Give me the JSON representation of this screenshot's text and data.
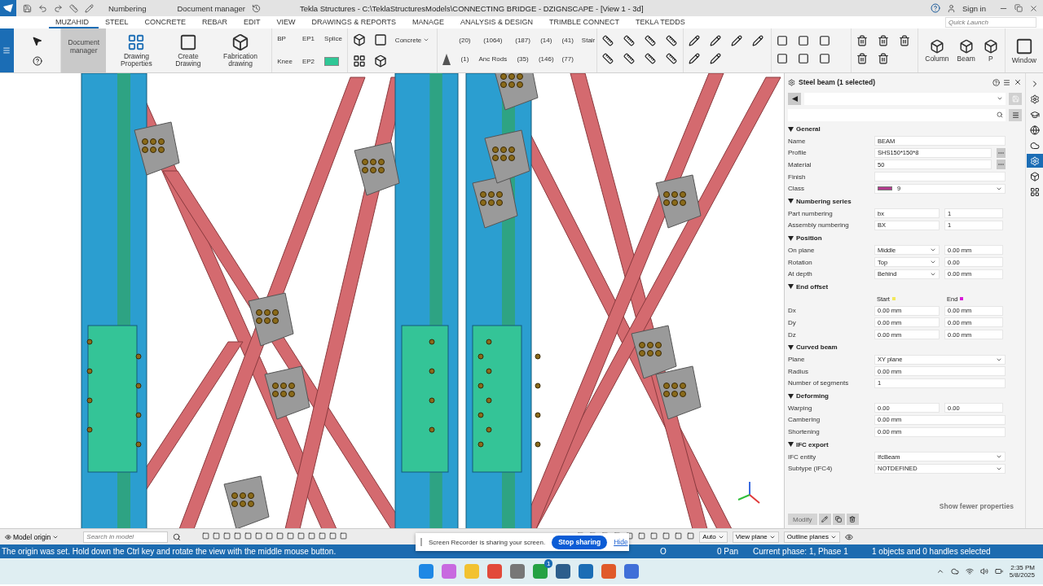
{
  "titlebar": {
    "quick_items": [
      "Numbering",
      "Document manager"
    ],
    "title": "Tekla Structures - C:\\TeklaStructuresModels\\CONNECTING BRIDGE - DZIGNSCAPE  - [View 1 - 3d]",
    "sign_in": "Sign in"
  },
  "tabs": [
    {
      "label": "MUZAHID",
      "selected": true
    },
    {
      "label": "STEEL",
      "selected": false
    },
    {
      "label": "CONCRETE",
      "selected": false
    },
    {
      "label": "REBAR",
      "selected": false
    },
    {
      "label": "EDIT",
      "selected": false
    },
    {
      "label": "VIEW",
      "selected": false
    },
    {
      "label": "DRAWINGS & REPORTS",
      "selected": false
    },
    {
      "label": "MANAGE",
      "selected": false
    },
    {
      "label": "ANALYSIS & DESIGN",
      "selected": false
    },
    {
      "label": "TRIMBLE CONNECT",
      "selected": false
    },
    {
      "label": "TEKLA TEDDS",
      "selected": false
    }
  ],
  "quick_launch": {
    "placeholder": "Quick Launch"
  },
  "ribbon": {
    "document_manager": "Document manager",
    "drawing_buttons": [
      {
        "label": "Drawing Properties",
        "kind": "props"
      },
      {
        "label": "Create Drawing",
        "kind": "create"
      },
      {
        "label": "Fabrication drawing",
        "kind": "fab"
      }
    ],
    "connections": [
      "BP",
      "EP1",
      "Splice",
      "Knee",
      "EP2"
    ],
    "concrete": "Concrete",
    "macro_rows": [
      [
        "(20)",
        "(1064)",
        "(187)",
        "(14)",
        "(41)",
        "Stair"
      ],
      [
        "(1)",
        "Anc Rods",
        "(35)",
        "(146)",
        "(77)"
      ]
    ],
    "part_buttons": [
      "Column",
      "Beam",
      "P"
    ],
    "window_button": "Window"
  },
  "panel": {
    "title": "Steel beam (1 selected)",
    "sections": [
      {
        "title": "General",
        "expanded": true,
        "rows": [
          {
            "kind": "text",
            "label": "Name",
            "value": "BEAM"
          },
          {
            "kind": "text_more",
            "label": "Profile",
            "value": "SHS150*150*8"
          },
          {
            "kind": "text_more",
            "label": "Material",
            "value": "50"
          },
          {
            "kind": "text",
            "label": "Finish",
            "value": ""
          },
          {
            "kind": "swatch",
            "label": "Class",
            "value": "9",
            "color": "#b23a8c"
          }
        ]
      },
      {
        "title": "Numbering series",
        "expanded": true,
        "rows": [
          {
            "kind": "pair",
            "label": "Part numbering",
            "value": "bx",
            "value2": "1"
          },
          {
            "kind": "pair",
            "label": "Assembly numbering",
            "value": "BX",
            "value2": "1"
          }
        ]
      },
      {
        "title": "Position",
        "expanded": true,
        "rows": [
          {
            "kind": "select_text",
            "label": "On plane",
            "value": "Middle",
            "value2": "0.00 mm"
          },
          {
            "kind": "select_text",
            "label": "Rotation",
            "value": "Top",
            "value2": "0.00"
          },
          {
            "kind": "select_text",
            "label": "At depth",
            "value": "Behind",
            "value2": "0.00 mm"
          }
        ]
      },
      {
        "title": "End offset",
        "expanded": true,
        "rows": [
          {
            "kind": "header",
            "label": "",
            "columns": [
              {
                "label": "Start",
                "color": "#f2e85c"
              },
              {
                "label": "End",
                "color": "#d81bd8"
              }
            ]
          },
          {
            "kind": "pair",
            "label": "Dx",
            "value": "0.00 mm",
            "value2": "0.00 mm"
          },
          {
            "kind": "pair",
            "label": "Dy",
            "value": "0.00 mm",
            "value2": "0.00 mm"
          },
          {
            "kind": "pair",
            "label": "Dz",
            "value": "0.00 mm",
            "value2": "0.00 mm"
          }
        ]
      },
      {
        "title": "Curved beam",
        "expanded": true,
        "rows": [
          {
            "kind": "select",
            "label": "Plane",
            "value": "XY plane"
          },
          {
            "kind": "text",
            "label": "Radius",
            "value": "0.00 mm"
          },
          {
            "kind": "text",
            "label": "Number of segments",
            "value": "1"
          }
        ]
      },
      {
        "title": "Deforming",
        "expanded": true,
        "rows": [
          {
            "kind": "pair",
            "label": "Warping",
            "value": "0.00",
            "value2": "0.00"
          },
          {
            "kind": "text",
            "label": "Cambering",
            "value": "0.00 mm"
          },
          {
            "kind": "text",
            "label": "Shortening",
            "value": "0.00 mm"
          }
        ]
      },
      {
        "title": "IFC export",
        "expanded": true,
        "rows": [
          {
            "kind": "select",
            "label": "IFC entity",
            "value": "IfcBeam"
          },
          {
            "kind": "select",
            "label": "Subtype (IFC4)",
            "value": "NOTDEFINED"
          }
        ]
      }
    ],
    "show_fewer": "Show fewer properties",
    "modify": {
      "label": "Modify",
      "disabled": true
    }
  },
  "side_tabs": [
    {
      "selected": false
    },
    {
      "selected": false
    },
    {
      "selected": false
    },
    {
      "selected": false
    },
    {
      "selected": true
    },
    {
      "selected": false
    },
    {
      "selected": false
    }
  ],
  "bottom_toolbar": {
    "origin": "Model origin",
    "search": {
      "placeholder": "Search in model"
    },
    "dropdowns": [
      "Auto",
      "View plane",
      "Outline planes"
    ]
  },
  "share_bar": {
    "message": "Screen Recorder is sharing your screen.",
    "stop": "Stop sharing",
    "hide": "Hide"
  },
  "status_bar": {
    "message": "The origin was set. Hold down the Ctrl key and rotate the view with the middle mouse button.",
    "items": [
      "O",
      "0 Pan",
      "Current phase: 1, Phase 1",
      "1 objects and 0 handles selected"
    ]
  },
  "taskbar": {
    "badge": "1",
    "time": "2:35 PM",
    "date": "5/8/2025"
  }
}
